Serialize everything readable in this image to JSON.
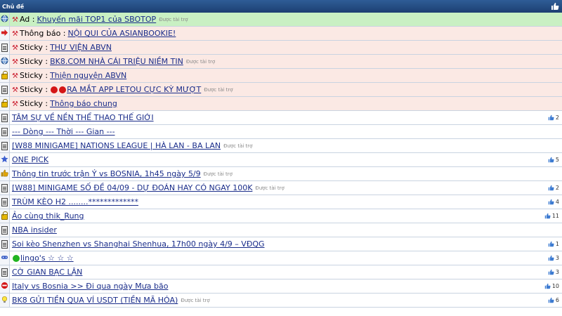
{
  "header": {
    "title": "Chủ đề"
  },
  "threads": [
    {
      "kind": "ad",
      "icon": "globe-icon",
      "prefix": "Ad :",
      "title": "Khuyến mãi TOP1 của SBOTOP",
      "sponsor": "Được tài trợ",
      "likes": ""
    },
    {
      "kind": "notice",
      "icon": "arrow-right-icon",
      "prefix": "Thông báo :",
      "title": "NỘI QUI CỦA ASIANBOOKIE!",
      "sponsor": "",
      "likes": ""
    },
    {
      "kind": "sticky",
      "icon": "doc-icon",
      "prefix": "Sticky :",
      "title": "THƯ VIỆN ABVN",
      "sponsor": "",
      "likes": ""
    },
    {
      "kind": "sticky",
      "icon": "globe-icon",
      "prefix": "Sticky :",
      "title": "BK8.COM NHÀ CÁI TRIỆU NIỀM TIN",
      "sponsor": "Được tài trợ",
      "likes": ""
    },
    {
      "kind": "sticky",
      "icon": "lock-icon",
      "prefix": "Sticky :",
      "title": "Thiện nguyện ABVN",
      "sponsor": "",
      "likes": ""
    },
    {
      "kind": "sticky",
      "icon": "doc-icon",
      "prefix": "Sticky :",
      "title": "RA MẮT APP LETOU CỰC KỲ MƯỢT",
      "sponsor": "Được tài trợ",
      "likes": ""
    },
    {
      "kind": "sticky",
      "icon": "lock-icon",
      "prefix": "Sticky :",
      "title": "Thông báo chung",
      "sponsor": "",
      "likes": ""
    },
    {
      "kind": "normal",
      "icon": "doc-icon",
      "prefix": "",
      "title": "TÂM SỰ VỀ NỀN THỂ THAO THẾ GIỚI",
      "sponsor": "",
      "likes": "2"
    },
    {
      "kind": "normal",
      "icon": "doc-icon",
      "prefix": "",
      "title": "--- Dòng --- Thời --- Gian ---",
      "sponsor": "",
      "likes": ""
    },
    {
      "kind": "normal",
      "icon": "doc-icon",
      "prefix": "",
      "title": "[W88 MINIGAME] NATIONS LEAGUE | HÀ LAN - BA LAN",
      "sponsor": "Được tài trợ",
      "likes": ""
    },
    {
      "kind": "normal",
      "icon": "star-icon",
      "prefix": "",
      "title": "ONE PICK",
      "sponsor": "",
      "likes": "5"
    },
    {
      "kind": "normal",
      "icon": "thumb-icon",
      "prefix": "",
      "title": "Thông tin trước trận Ý vs BOSNIA, 1h45 ngày 5/9",
      "sponsor": "Được tài trợ",
      "likes": ""
    },
    {
      "kind": "normal",
      "icon": "doc-icon",
      "prefix": "",
      "title": "[W88] MINIGAME SỐ ĐỀ 04/09 - DỰ ĐOÁN HAY CÓ NGAY 100K",
      "sponsor": "Được tài trợ",
      "likes": "2"
    },
    {
      "kind": "normal",
      "icon": "doc-icon",
      "prefix": "",
      "title": "TRÙM KÈO H2 ........*************",
      "sponsor": "",
      "likes": "4"
    },
    {
      "kind": "normal",
      "icon": "lock-icon",
      "prefix": "",
      "title": "Ảo cùng thik_Rung",
      "sponsor": "",
      "likes": "11"
    },
    {
      "kind": "normal",
      "icon": "doc-icon",
      "prefix": "",
      "title": "NBA insider",
      "sponsor": "",
      "likes": ""
    },
    {
      "kind": "normal",
      "icon": "doc-icon",
      "prefix": "",
      "title": "Soi kèo Shenzhen vs Shanghai Shenhua, 17h00 ngày 4/9 – VĐQG",
      "sponsor": "",
      "likes": "1"
    },
    {
      "kind": "normal",
      "icon": "gamepad-icon",
      "prefix": "",
      "title": "lingo's ☆ ☆ ☆",
      "sponsor": "",
      "likes": "3"
    },
    {
      "kind": "normal",
      "icon": "doc-icon",
      "prefix": "",
      "title": "CỜ GIAN BẠC LẬN",
      "sponsor": "",
      "likes": "3"
    },
    {
      "kind": "normal",
      "icon": "no-entry-icon",
      "prefix": "",
      "title": "Italy vs Bosnia >> Đi qua ngày Mưa bão",
      "sponsor": "",
      "likes": "10"
    },
    {
      "kind": "normal",
      "icon": "bulb-icon",
      "prefix": "",
      "title": "BK8 GỬI TIỀN QUA VÍ USDT (TIỀN MÃ HÓA)",
      "sponsor": "Được tài trợ",
      "likes": "6"
    }
  ],
  "colors": {
    "header": "#1d3f72",
    "link": "#1a2d8a",
    "ad_bg": "#c9f0c3",
    "sticky_bg": "#fbe9e4"
  }
}
